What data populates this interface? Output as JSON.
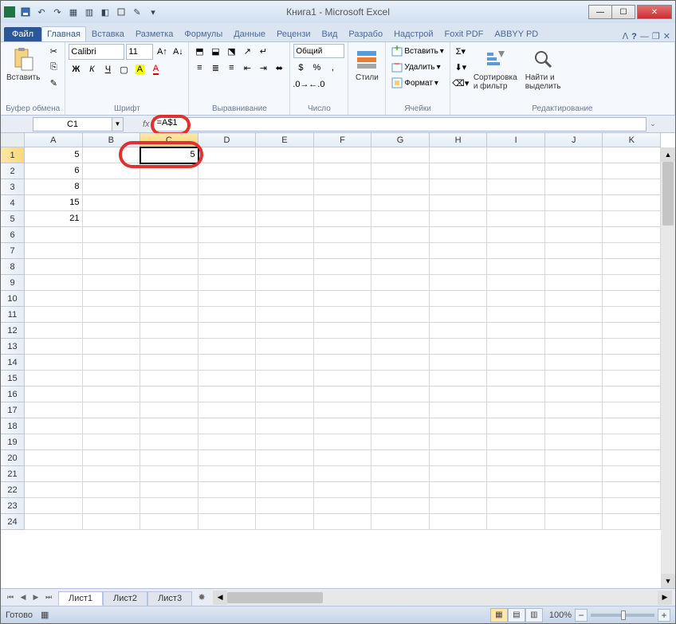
{
  "title": "Книга1  -  Microsoft Excel",
  "tabs": {
    "file": "Файл",
    "items": [
      "Главная",
      "Вставка",
      "Разметка",
      "Формулы",
      "Данные",
      "Рецензи",
      "Вид",
      "Разрабо",
      "Надстрой",
      "Foxit PDF",
      "ABBYY PD"
    ],
    "active": 0
  },
  "ribbon": {
    "clipboard": {
      "paste": "Вставить",
      "label": "Буфер обмена"
    },
    "font": {
      "name": "Calibri",
      "size": "11",
      "label": "Шрифт"
    },
    "align": {
      "label": "Выравнивание"
    },
    "number": {
      "format": "Общий",
      "label": "Число"
    },
    "styles": {
      "btn": "Стили"
    },
    "cells": {
      "insert": "Вставить",
      "delete": "Удалить",
      "format": "Формат",
      "label": "Ячейки"
    },
    "editing": {
      "sort": "Сортировка\nи фильтр",
      "find": "Найти и\nвыделить",
      "label": "Редактирование"
    }
  },
  "namebox": "C1",
  "formula": "=A$1",
  "columns": [
    "A",
    "B",
    "C",
    "D",
    "E",
    "F",
    "G",
    "H",
    "I",
    "J",
    "K"
  ],
  "sel_col": 2,
  "rows": 24,
  "sel_row": 0,
  "cells": {
    "A1": "5",
    "A2": "6",
    "A3": "8",
    "A4": "15",
    "A5": "21",
    "C1": "5"
  },
  "selected": "C1",
  "sheets": {
    "items": [
      "Лист1",
      "Лист2",
      "Лист3"
    ],
    "active": 0
  },
  "status": "Готово",
  "zoom": "100%"
}
